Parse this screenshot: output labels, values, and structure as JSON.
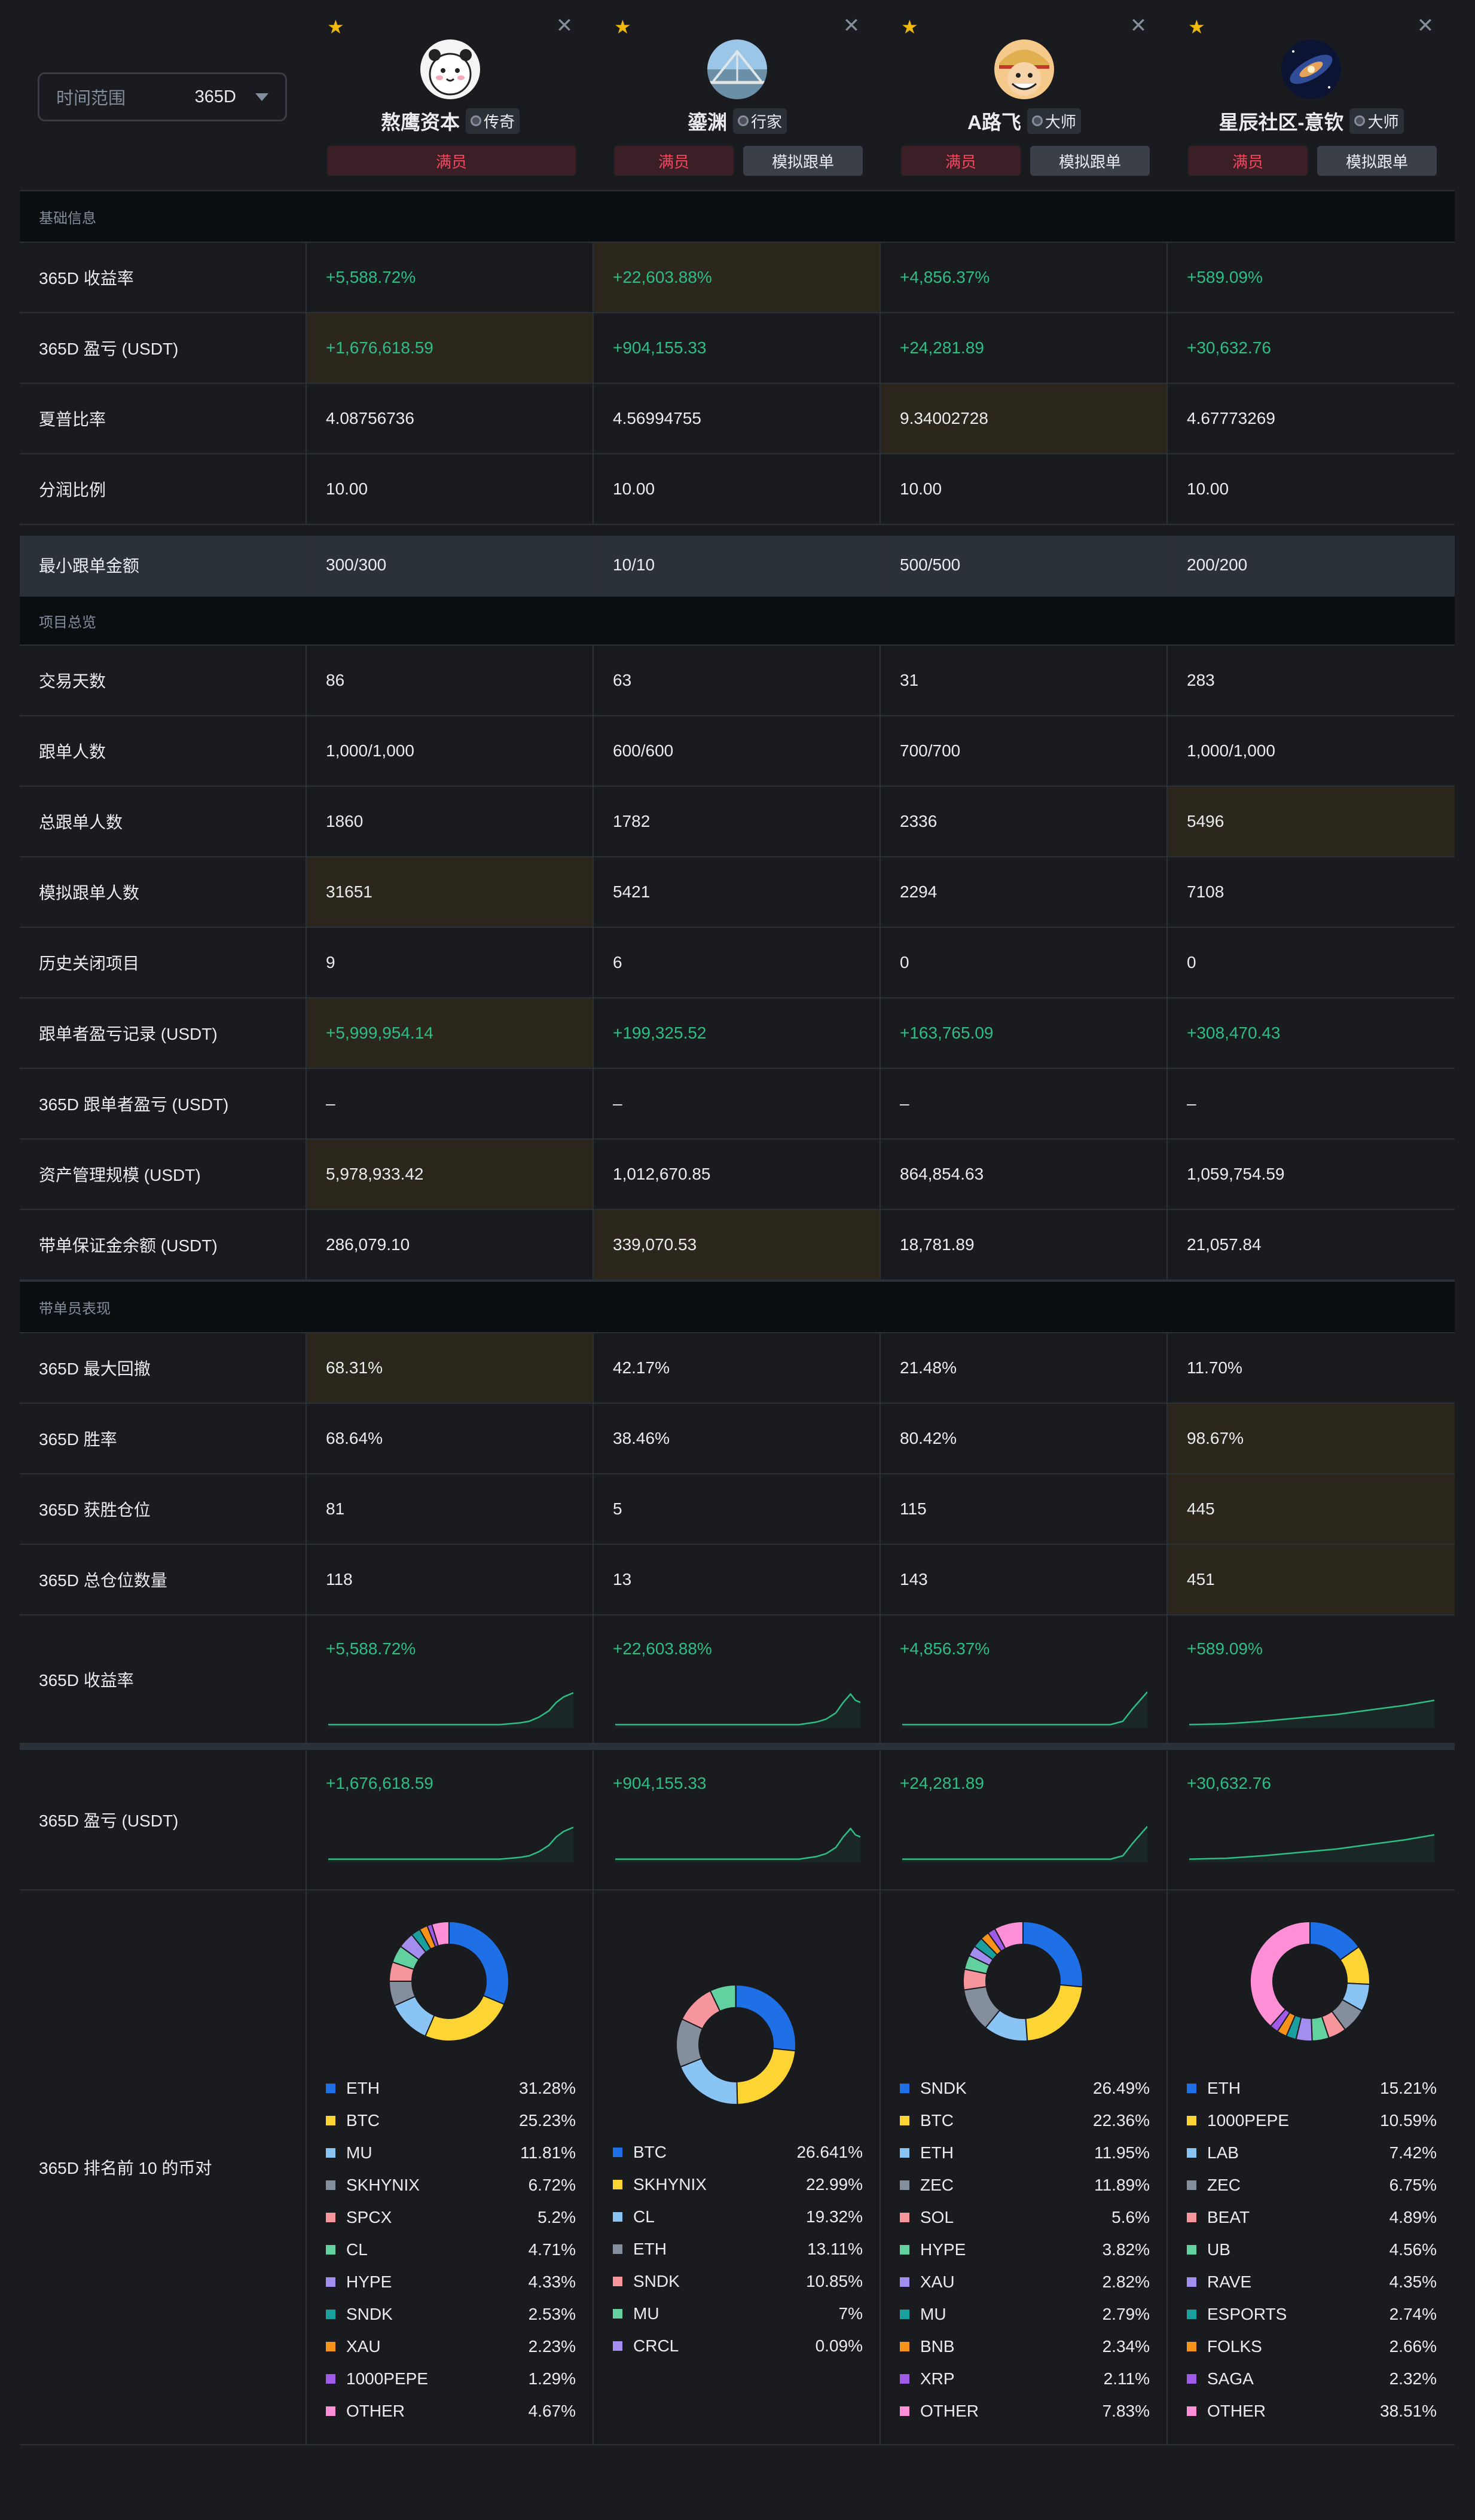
{
  "time_range": {
    "label": "时间范围",
    "value": "365D"
  },
  "traders": [
    {
      "name": "熬鹰资本",
      "badge": "传奇",
      "full": "满员",
      "sim": ""
    },
    {
      "name": "鎏渊",
      "badge": "行家",
      "full": "满员",
      "sim": "模拟跟单"
    },
    {
      "name": "A路飞",
      "badge": "大师",
      "full": "满员",
      "sim": "模拟跟单"
    },
    {
      "name": "星辰社区-意钦",
      "badge": "大师",
      "full": "满员",
      "sim": "模拟跟单"
    }
  ],
  "sections": {
    "basic": "基础信息",
    "overview": "项目总览",
    "perf": "带单员表现"
  },
  "rows": {
    "roi": {
      "label": "365D 收益率",
      "v": [
        "+5,588.72%",
        "+22,603.88%",
        "+4,856.37%",
        "+589.09%"
      ]
    },
    "pnl": {
      "label": "365D 盈亏 (USDT)",
      "v": [
        "+1,676,618.59",
        "+904,155.33",
        "+24,281.89",
        "+30,632.76"
      ]
    },
    "sharpe": {
      "label": "夏普比率",
      "v": [
        "4.08756736",
        "4.56994755",
        "9.34002728",
        "4.67773269"
      ]
    },
    "share": {
      "label": "分润比例",
      "v": [
        "10.00",
        "10.00",
        "10.00",
        "10.00"
      ]
    },
    "minamt": {
      "label": "最小跟单金额",
      "v": [
        "300/300",
        "10/10",
        "500/500",
        "200/200"
      ]
    },
    "days": {
      "label": "交易天数",
      "v": [
        "86",
        "63",
        "31",
        "283"
      ]
    },
    "followers": {
      "label": "跟单人数",
      "v": [
        "1,000/1,000",
        "600/600",
        "700/700",
        "1,000/1,000"
      ]
    },
    "total_followers": {
      "label": "总跟单人数",
      "v": [
        "1860",
        "1782",
        "2336",
        "5496"
      ]
    },
    "sim_followers": {
      "label": "模拟跟单人数",
      "v": [
        "31651",
        "5421",
        "2294",
        "7108"
      ]
    },
    "closed": {
      "label": "历史关闭项目",
      "v": [
        "9",
        "6",
        "0",
        "0"
      ]
    },
    "follower_pnl": {
      "label": "跟单者盈亏记录 (USDT)",
      "v": [
        "+5,999,954.14",
        "+199,325.52",
        "+163,765.09",
        "+308,470.43"
      ]
    },
    "follower_pnl365": {
      "label": "365D 跟单者盈亏 (USDT)",
      "v": [
        "–",
        "–",
        "–",
        "–"
      ]
    },
    "aum": {
      "label": "资产管理规模 (USDT)",
      "v": [
        "5,978,933.42",
        "1,012,670.85",
        "864,854.63",
        "1,059,754.59"
      ]
    },
    "margin": {
      "label": "带单保证金余额 (USDT)",
      "v": [
        "286,079.10",
        "339,070.53",
        "18,781.89",
        "21,057.84"
      ]
    },
    "mdd": {
      "label": "365D 最大回撤",
      "v": [
        "68.31%",
        "42.17%",
        "21.48%",
        "11.70%"
      ]
    },
    "winrate": {
      "label": "365D 胜率",
      "v": [
        "68.64%",
        "38.46%",
        "80.42%",
        "98.67%"
      ]
    },
    "wins": {
      "label": "365D 获胜仓位",
      "v": [
        "81",
        "5",
        "115",
        "445"
      ]
    },
    "positions": {
      "label": "365D 总仓位数量",
      "v": [
        "118",
        "13",
        "143",
        "451"
      ]
    },
    "roi_chart": {
      "label": "365D 收益率",
      "v": [
        "+5,588.72%",
        "+22,603.88%",
        "+4,856.37%",
        "+589.09%"
      ]
    },
    "pnl_chart": {
      "label": "365D 盈亏 (USDT)",
      "v": [
        "+1,676,618.59",
        "+904,155.33",
        "+24,281.89",
        "+30,632.76"
      ]
    },
    "top10": {
      "label": "365D 排名前 10 的币对"
    }
  },
  "colors": [
    "#1f6fe6",
    "#fcd535",
    "#8ac4f5",
    "#848e9c",
    "#f6959b",
    "#63d0a0",
    "#a38ef0",
    "#1a9e9e",
    "#f7931a",
    "#9f5ae8",
    "#ff8fd6"
  ],
  "chart_data": [
    {
      "type": "pie",
      "series": [
        {
          "labels": [
            "ETH",
            "BTC",
            "MU",
            "SKHYNIX",
            "SPCX",
            "CL",
            "HYPE",
            "SNDK",
            "XAU",
            "1000PEPE",
            "OTHER"
          ],
          "pct": [
            "31.28%",
            "25.23%",
            "11.81%",
            "6.72%",
            "5.2%",
            "4.71%",
            "4.33%",
            "2.53%",
            "2.23%",
            "1.29%",
            "4.67%"
          ],
          "values": [
            31.28,
            25.23,
            11.81,
            6.72,
            5.2,
            4.71,
            4.33,
            2.53,
            2.23,
            1.29,
            4.67
          ]
        }
      ]
    },
    {
      "type": "pie",
      "series": [
        {
          "labels": [
            "BTC",
            "SKHYNIX",
            "CL",
            "ETH",
            "SNDK",
            "MU",
            "CRCL"
          ],
          "pct": [
            "26.641%",
            "22.99%",
            "19.32%",
            "13.11%",
            "10.85%",
            "7%",
            "0.09%"
          ],
          "values": [
            26.641,
            22.99,
            19.32,
            13.11,
            10.85,
            7,
            0.09
          ]
        }
      ]
    },
    {
      "type": "pie",
      "series": [
        {
          "labels": [
            "SNDK",
            "BTC",
            "ETH",
            "ZEC",
            "SOL",
            "HYPE",
            "XAU",
            "MU",
            "BNB",
            "XRP",
            "OTHER"
          ],
          "pct": [
            "26.49%",
            "22.36%",
            "11.95%",
            "11.89%",
            "5.6%",
            "3.82%",
            "2.82%",
            "2.79%",
            "2.34%",
            "2.11%",
            "7.83%"
          ],
          "values": [
            26.49,
            22.36,
            11.95,
            11.89,
            5.6,
            3.82,
            2.82,
            2.79,
            2.34,
            2.11,
            7.83
          ]
        }
      ]
    },
    {
      "type": "pie",
      "series": [
        {
          "labels": [
            "ETH",
            "1000PEPE",
            "LAB",
            "ZEC",
            "BEAT",
            "UB",
            "RAVE",
            "ESPORTS",
            "FOLKS",
            "SAGA",
            "OTHER"
          ],
          "pct": [
            "15.21%",
            "10.59%",
            "7.42%",
            "6.75%",
            "4.89%",
            "4.56%",
            "4.35%",
            "2.74%",
            "2.66%",
            "2.32%",
            "38.51%"
          ],
          "values": [
            15.21,
            10.59,
            7.42,
            6.75,
            4.89,
            4.56,
            4.35,
            2.74,
            2.66,
            2.32,
            38.51
          ]
        }
      ]
    }
  ]
}
